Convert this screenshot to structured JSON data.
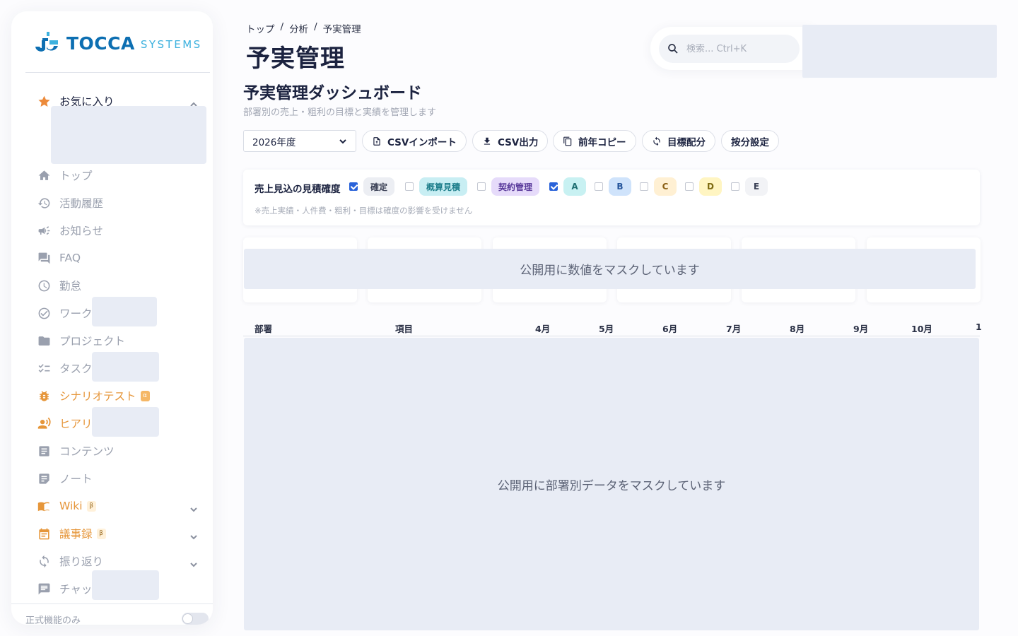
{
  "brand": {
    "name": "TOCCA",
    "sub": "SYSTEMS",
    "primary_color": "#0d6fb2",
    "accent_color": "#3db1de"
  },
  "sidebar": {
    "favorites_label": "お気に入り",
    "items": [
      {
        "label": "トップ",
        "icon": "home-icon"
      },
      {
        "label": "活動履歴",
        "icon": "history-icon"
      },
      {
        "label": "お知らせ",
        "icon": "megaphone-icon"
      },
      {
        "label": "FAQ",
        "icon": "chat-icon"
      },
      {
        "label": "勤怠",
        "icon": "clock-icon"
      },
      {
        "label": "ワーク",
        "icon": "check-circle-icon"
      },
      {
        "label": "プロジェクト",
        "icon": "folder-icon"
      },
      {
        "label": "タスク",
        "icon": "checklist-icon"
      },
      {
        "label": "シナリオテスト",
        "icon": "bug-icon",
        "badge": "α"
      },
      {
        "label": "ヒアリ",
        "icon": "voice-icon"
      },
      {
        "label": "コンテンツ",
        "icon": "document-icon"
      },
      {
        "label": "ノート",
        "icon": "note-icon"
      },
      {
        "label": "Wiki",
        "icon": "book-icon",
        "badge": "β"
      },
      {
        "label": "議事録",
        "icon": "calendar-icon",
        "badge": "β"
      },
      {
        "label": "振り返り",
        "icon": "refresh-icon"
      },
      {
        "label": "チャッ",
        "icon": "comment-icon"
      }
    ],
    "official_only_label": "正式機能のみ"
  },
  "header": {
    "breadcrumb": [
      "トップ",
      "分析",
      "予実管理"
    ],
    "breadcrumb_sep": "/",
    "title": "予実管理",
    "search_placeholder": "検索... Ctrl+K"
  },
  "dashboard": {
    "title": "予実管理ダッシュボード",
    "description": "部署別の売上・粗利の目標と実績を管理します"
  },
  "toolbar": {
    "fiscal_year": "2026年度",
    "csv_import": "CSVインポート",
    "csv_export": "CSV出力",
    "copy_prev_year": "前年コピー",
    "target_allocation": "目標配分",
    "apportion_settings": "按分設定"
  },
  "confidence": {
    "label": "売上見込の見積確度",
    "options": [
      {
        "label": "確定",
        "checked": true,
        "bg": "#eceef3",
        "fg": "#3a4055"
      },
      {
        "label": "概算見積",
        "checked": false,
        "bg": "#c8eef3",
        "fg": "#1f7f8c"
      },
      {
        "label": "契約管理",
        "checked": false,
        "bg": "#e6dbfa",
        "fg": "#5b3c9c"
      },
      {
        "label": "A",
        "checked": true,
        "bg": "#c8f1f2",
        "fg": "#1f6f72"
      },
      {
        "label": "B",
        "checked": false,
        "bg": "#cfe3fb",
        "fg": "#25559b"
      },
      {
        "label": "C",
        "checked": false,
        "bg": "#fff0d3",
        "fg": "#8a5f14"
      },
      {
        "label": "D",
        "checked": false,
        "bg": "#fff5c2",
        "fg": "#7d6a10"
      },
      {
        "label": "E",
        "checked": false,
        "bg": "#f2f3f6",
        "fg": "#3a4055"
      }
    ],
    "note": "※売上実績・人件費・粗利・目標は確度の影響を受けません"
  },
  "masks": {
    "kpi": "公開用に数値をマスクしています",
    "table": "公開用に部署別データをマスクしています"
  },
  "table": {
    "columns": [
      "部署",
      "項目",
      "4月",
      "5月",
      "6月",
      "7月",
      "8月",
      "9月",
      "10月",
      "1"
    ]
  }
}
